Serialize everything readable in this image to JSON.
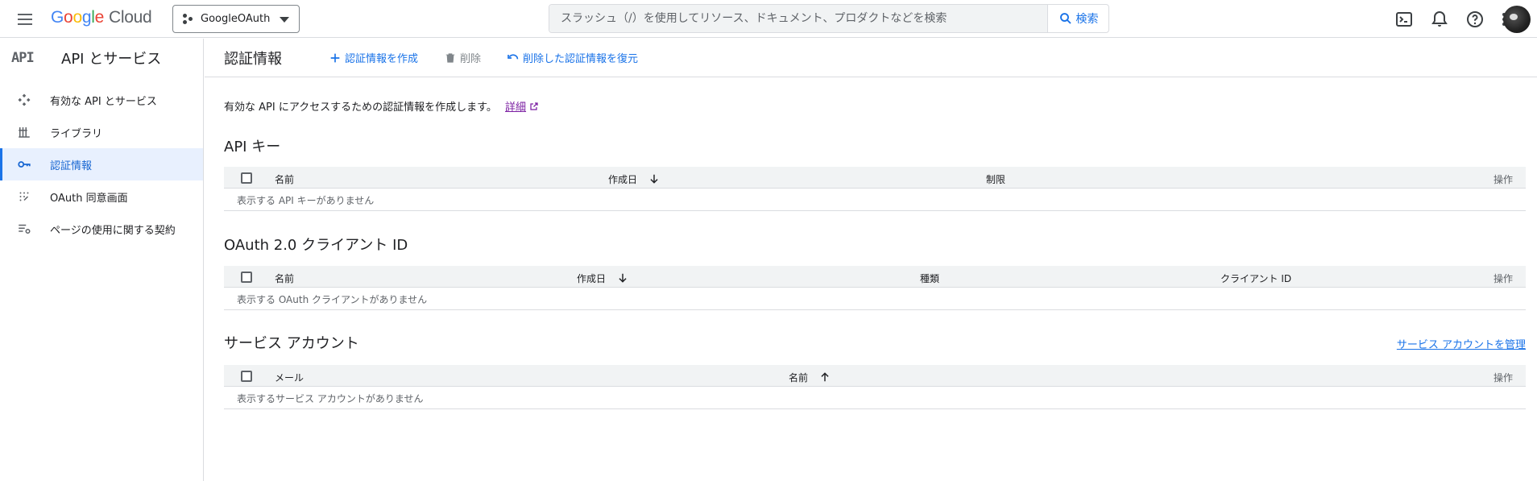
{
  "header": {
    "logo_google": [
      "G",
      "o",
      "o",
      "g",
      "l",
      "e"
    ],
    "logo_cloud": "Cloud",
    "project_name": "GoogleOAuth",
    "search_placeholder": "スラッシュ（/）を使用してリソース、ドキュメント、プロダクトなどを検索",
    "search_button": "検索",
    "icons": [
      "terminal-icon",
      "bell-icon",
      "help-icon",
      "more-vert-icon",
      "avatar"
    ]
  },
  "sidebar": {
    "logo": "API",
    "title": "API とサービス",
    "items": [
      {
        "label": "有効な API とサービス",
        "icon": "enabled-apis-icon",
        "active": false
      },
      {
        "label": "ライブラリ",
        "icon": "library-icon",
        "active": false
      },
      {
        "label": "認証情報",
        "icon": "key-icon",
        "active": true
      },
      {
        "label": "OAuth 同意画面",
        "icon": "consent-icon",
        "active": false
      },
      {
        "label": "ページの使用に関する契約",
        "icon": "settings-list-icon",
        "active": false
      }
    ]
  },
  "toolbar": {
    "title": "認証情報",
    "create": "認証情報を作成",
    "delete": "削除",
    "restore": "削除した認証情報を復元"
  },
  "intro": {
    "text": "有効な API にアクセスするための認証情報を作成します。",
    "link": "詳細"
  },
  "api_keys": {
    "title": "API キー",
    "col_name": "名前",
    "col_created": "作成日",
    "col_restrictions": "制限",
    "col_actions": "操作",
    "empty": "表示する API キーがありません"
  },
  "oauth": {
    "title": "OAuth 2.0 クライアント ID",
    "col_name": "名前",
    "col_created": "作成日",
    "col_type": "種類",
    "col_client_id": "クライアント ID",
    "col_actions": "操作",
    "empty": "表示する OAuth クライアントがありません"
  },
  "service_accounts": {
    "title": "サービス アカウント",
    "manage_link": "サービス アカウントを管理",
    "col_email": "メール",
    "col_name": "名前",
    "col_actions": "操作",
    "empty": "表示するサービス アカウントがありません"
  },
  "colors": {
    "accent": "#1a73e8",
    "active_bg": "#e8f0fe",
    "header_row": "#f1f3f4",
    "link_visited": "#7b1fa2"
  }
}
